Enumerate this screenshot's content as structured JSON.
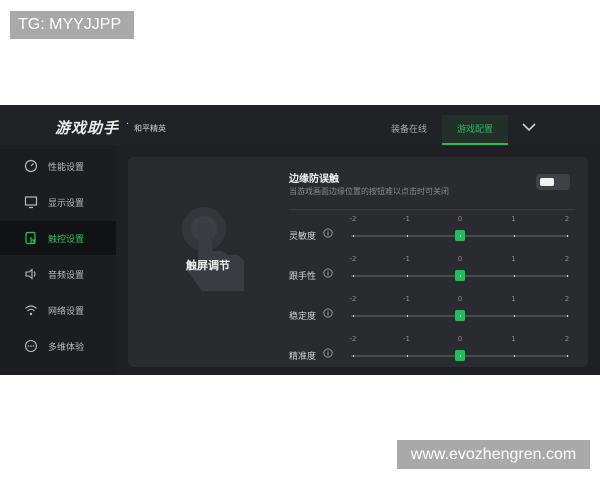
{
  "watermarks": {
    "top_left": "TG: MYYJJPP",
    "bottom_right": "www.evozhengren.com"
  },
  "header": {
    "brand": "游戏助手",
    "dot": "·",
    "subtitle": "和平精英",
    "tabs": [
      {
        "label": "装备在线",
        "active": false
      },
      {
        "label": "游戏配置",
        "active": true
      }
    ],
    "dropdown_icon": "chevron-down-icon"
  },
  "sidebar": {
    "items": [
      {
        "label": "性能设置",
        "icon": "gauge-icon",
        "active": false
      },
      {
        "label": "显示设置",
        "icon": "monitor-icon",
        "active": false
      },
      {
        "label": "触控设置",
        "icon": "touch-icon",
        "active": true
      },
      {
        "label": "音频设置",
        "icon": "speaker-icon",
        "active": false
      },
      {
        "label": "网络设置",
        "icon": "wifi-icon",
        "active": false
      },
      {
        "label": "多维体验",
        "icon": "more-icon",
        "active": false
      }
    ]
  },
  "panel": {
    "section_label": "触屏调节",
    "edge": {
      "title": "边缘防误触",
      "description": "当游戏画面边缘位置的按钮难以点击时可关闭",
      "toggle_on": false
    },
    "scale_ticks": [
      "-2",
      "-1",
      "0",
      "1",
      "2"
    ],
    "sliders": [
      {
        "label": "灵敏度",
        "value": 0
      },
      {
        "label": "跟手性",
        "value": 0
      },
      {
        "label": "稳定度",
        "value": 0
      },
      {
        "label": "精准度",
        "value": 0
      }
    ]
  },
  "colors": {
    "accent": "#1fbf5b",
    "background": "#1e2023",
    "panel": "#292b2f"
  }
}
